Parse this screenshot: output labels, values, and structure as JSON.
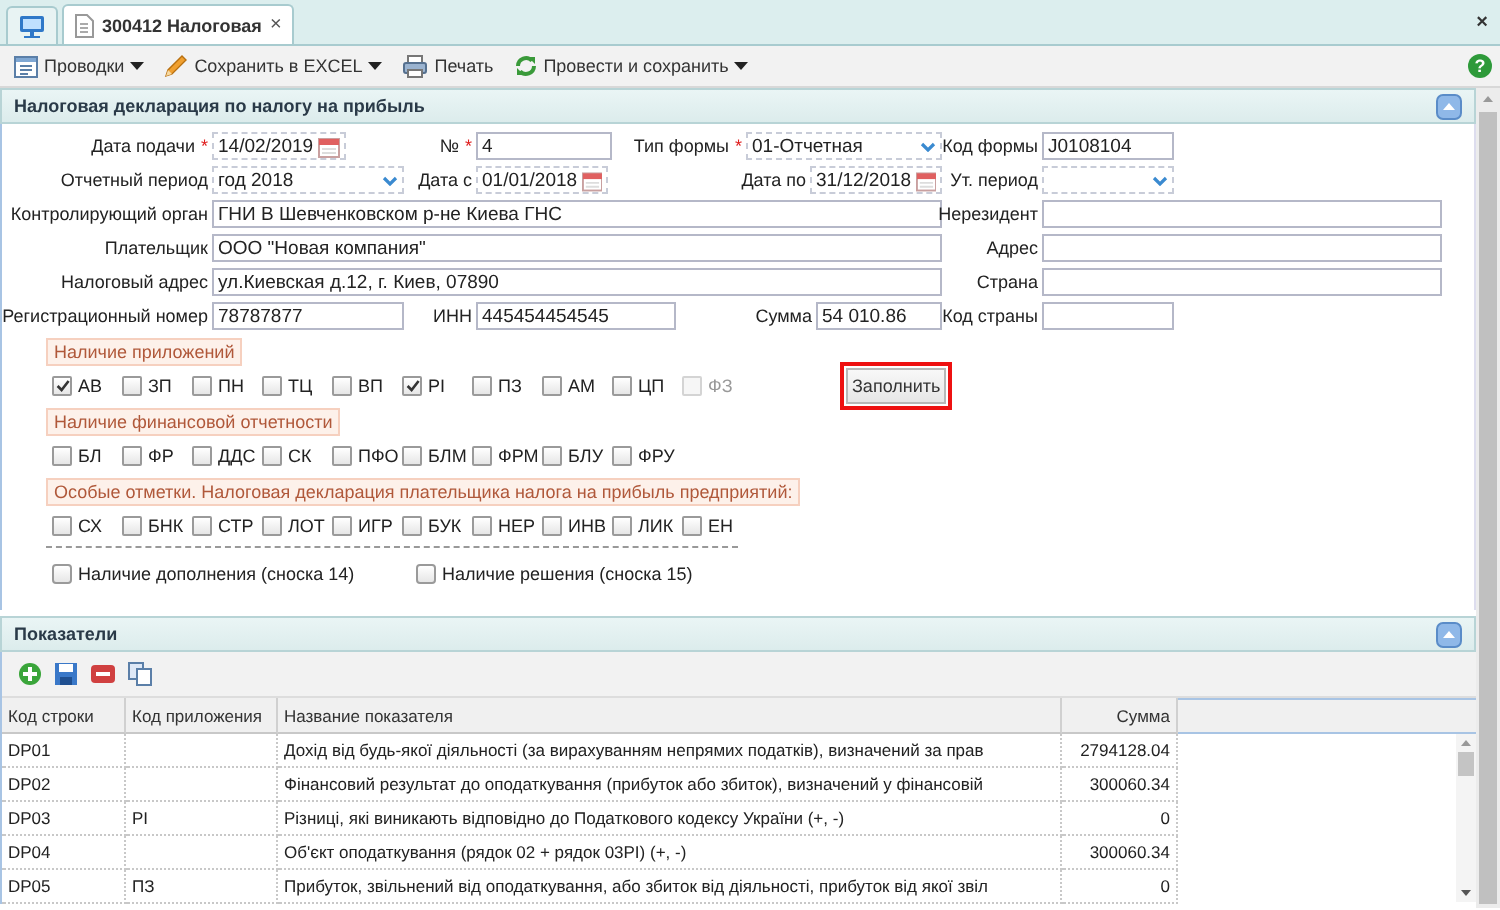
{
  "tabs": [
    {
      "kind": "home",
      "selected": false
    },
    {
      "kind": "document",
      "label": "300412 Налоговая",
      "close": "×",
      "selected": true
    }
  ],
  "window_close": "×",
  "toolbar": {
    "items": [
      {
        "label": "Проводки",
        "dropdown": true
      },
      {
        "label": "Сохранить в EXCEL",
        "dropdown": true
      },
      {
        "label": "Печать",
        "dropdown": false
      },
      {
        "label": "Провести и сохранить",
        "dropdown": true
      }
    ],
    "help": "?"
  },
  "declaration": {
    "title": "Налоговая декларация по налогу на прибыль",
    "rows": [
      [
        {
          "label": "Дата подачи",
          "required_mark": "*",
          "value": "14/02/2019",
          "kind": "date"
        },
        {
          "label": "№",
          "required_mark": "*",
          "value": "4",
          "kind": "text"
        },
        {
          "label": "Тип формы",
          "required_mark": "*",
          "value": "01-Отчетная",
          "kind": "select"
        },
        {
          "label": "Код формы",
          "value": "J0108104",
          "kind": "text"
        }
      ],
      [
        {
          "label": "Отчетный период",
          "value": "год 2018",
          "kind": "select"
        },
        {
          "label": "Дата с",
          "value": "01/01/2018",
          "kind": "date"
        },
        {
          "label": "Дата по",
          "value": "31/12/2018",
          "kind": "date"
        },
        {
          "label": "Ут. период",
          "kind": "select"
        }
      ],
      [
        {
          "label": "Контролирующий орган",
          "value": "ГНИ В Шевченковском р-не Киева ГНС",
          "kind": "text"
        },
        {
          "label": "Нерезидент",
          "kind": "text"
        }
      ],
      [
        {
          "label": "Плательщик",
          "value": "ООО \"Новая компания\"",
          "kind": "text"
        },
        {
          "label": "Адрес",
          "kind": "text"
        }
      ],
      [
        {
          "label": "Налоговый адрес",
          "value": "ул.Киевская д.12, г. Киев, 07890",
          "kind": "text"
        },
        {
          "label": "Страна",
          "kind": "text"
        }
      ],
      [
        {
          "label": "Регистрационный номер",
          "value": "78787877",
          "kind": "text"
        },
        {
          "label": "ИНН",
          "value": "445454454545",
          "kind": "text"
        },
        {
          "label": "Сумма",
          "value": "54 010.86",
          "kind": "text"
        },
        {
          "label": "Код страны",
          "kind": "text"
        }
      ]
    ],
    "groups": [
      {
        "title": "Наличие приложений",
        "items": [
          {
            "label": "АВ",
            "checked": true,
            "disabled": false
          },
          {
            "label": "ЗП",
            "checked": false,
            "disabled": false
          },
          {
            "label": "ПН",
            "checked": false,
            "disabled": false
          },
          {
            "label": "ТЦ",
            "checked": false,
            "disabled": false
          },
          {
            "label": "ВП",
            "checked": false,
            "disabled": false
          },
          {
            "label": "РІ",
            "checked": true,
            "disabled": false
          },
          {
            "label": "ПЗ",
            "checked": false,
            "disabled": false
          },
          {
            "label": "АМ",
            "checked": false,
            "disabled": false
          },
          {
            "label": "ЦП",
            "checked": false,
            "disabled": false
          },
          {
            "label": "ФЗ",
            "checked": false,
            "disabled": true
          }
        ]
      },
      {
        "title": "Наличие финансовой отчетности",
        "items": [
          {
            "label": "БЛ",
            "checked": false
          },
          {
            "label": "ФР",
            "checked": false
          },
          {
            "label": "ДДС",
            "checked": false
          },
          {
            "label": "СК",
            "checked": false
          },
          {
            "label": "ПФО",
            "checked": false
          },
          {
            "label": "БЛМ",
            "checked": false
          },
          {
            "label": "ФРМ",
            "checked": false
          },
          {
            "label": "БЛУ",
            "checked": false
          },
          {
            "label": "ФРУ",
            "checked": false
          }
        ]
      },
      {
        "title": "Особые отметки. Налоговая декларация плательщика налога на прибыль предприятий:",
        "items": [
          {
            "label": "СХ",
            "checked": false
          },
          {
            "label": "БНК",
            "checked": false
          },
          {
            "label": "СТР",
            "checked": false
          },
          {
            "label": "ЛОТ",
            "checked": false
          },
          {
            "label": "ИГР",
            "checked": false
          },
          {
            "label": "БУК",
            "checked": false
          },
          {
            "label": "НЕР",
            "checked": false
          },
          {
            "label": "ИНВ",
            "checked": false
          },
          {
            "label": "ЛИК",
            "checked": false
          },
          {
            "label": "ЕН",
            "checked": false
          }
        ]
      }
    ],
    "extras": [
      {
        "label": "Наличие дополнения (сноска 14)",
        "checked": false
      },
      {
        "label": "Наличие решения (сноска 15)",
        "checked": false
      }
    ],
    "fill_button": {
      "label": "Заполнить",
      "highlighted": true
    }
  },
  "indicators": {
    "title": "Показатели",
    "columns": [
      "Код строки",
      "Код приложения",
      "Название показателя",
      "Сумма"
    ],
    "rows": [
      {
        "code": "DP01",
        "name": "Дохід від будь-якої діяльності (за вирахуванням непрямих податків), визначений за прав",
        "sum": "2794128.04"
      },
      {
        "code": "DP02",
        "name": "Фінансовий результат до оподаткування (прибуток або збиток), визначений у фінансовій",
        "sum": "300060.34"
      },
      {
        "code": "DP03",
        "appendix": "РІ",
        "name": "Різниці, які виникають відповідно до Податкового кодексу України (+, -)",
        "sum": "0"
      },
      {
        "code": "DP04",
        "name": "Об'єкт оподаткування (рядок 02 + рядок 03РІ) (+, -)",
        "sum": "300060.34"
      },
      {
        "code": "DP05",
        "appendix": "ПЗ",
        "name": "Прибуток, звільнений від оподаткування, або збиток від діяльності, прибуток від якої звіл",
        "sum": "0"
      }
    ]
  }
}
